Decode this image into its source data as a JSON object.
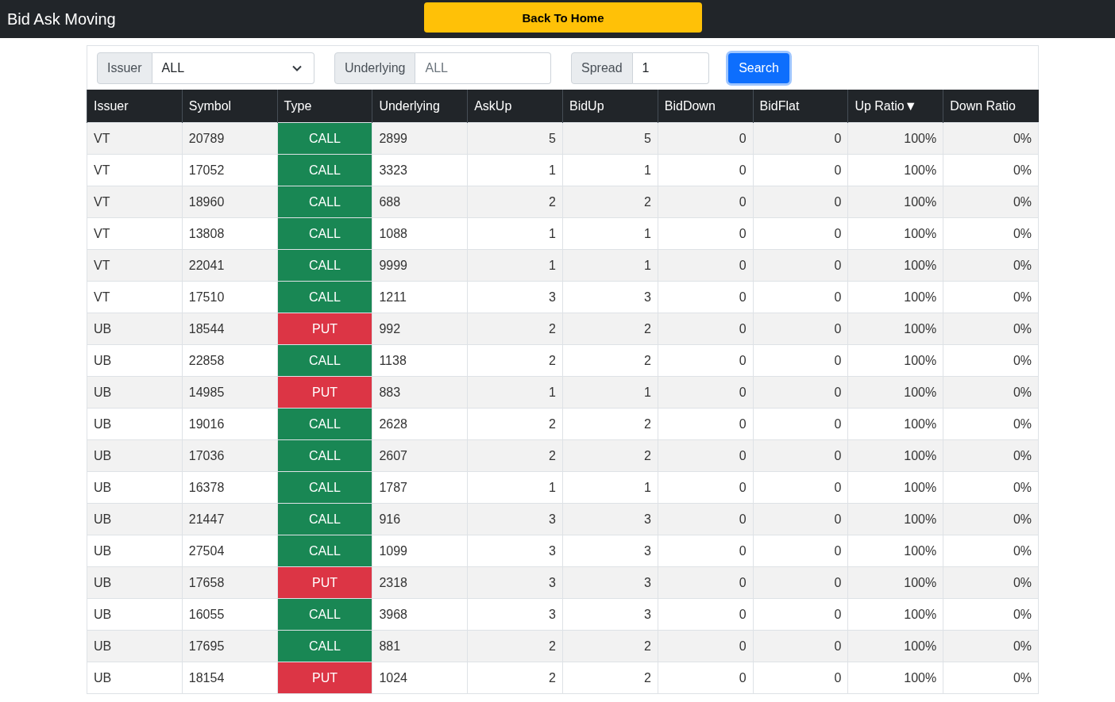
{
  "navbar": {
    "title": "Bid Ask Moving",
    "home_button": "Back To Home"
  },
  "filters": {
    "issuer": {
      "label": "Issuer",
      "value": "ALL"
    },
    "underlying": {
      "label": "Underlying",
      "placeholder": "ALL"
    },
    "spread": {
      "label": "Spread",
      "value": "1"
    },
    "search_button": "Search"
  },
  "table": {
    "columns": [
      "Issuer",
      "Symbol",
      "Type",
      "Underlying",
      "AskUp",
      "BidUp",
      "BidDown",
      "BidFlat",
      "Up Ratio▼",
      "Down Ratio"
    ],
    "rows": [
      {
        "issuer": "VT",
        "symbol": "20789",
        "type": "CALL",
        "color": "#198754",
        "underlying": "2899",
        "ask_up": "5",
        "bid_up": "5",
        "bid_down": "0",
        "bid_flat": "0",
        "up_ratio": "100%",
        "down_ratio": "0%"
      },
      {
        "issuer": "VT",
        "symbol": "17052",
        "type": "CALL",
        "color": "#198754",
        "underlying": "3323",
        "ask_up": "1",
        "bid_up": "1",
        "bid_down": "0",
        "bid_flat": "0",
        "up_ratio": "100%",
        "down_ratio": "0%"
      },
      {
        "issuer": "VT",
        "symbol": "18960",
        "type": "CALL",
        "color": "#198754",
        "underlying": "688",
        "ask_up": "2",
        "bid_up": "2",
        "bid_down": "0",
        "bid_flat": "0",
        "up_ratio": "100%",
        "down_ratio": "0%"
      },
      {
        "issuer": "VT",
        "symbol": "13808",
        "type": "CALL",
        "color": "#198754",
        "underlying": "1088",
        "ask_up": "1",
        "bid_up": "1",
        "bid_down": "0",
        "bid_flat": "0",
        "up_ratio": "100%",
        "down_ratio": "0%"
      },
      {
        "issuer": "VT",
        "symbol": "22041",
        "type": "CALL",
        "color": "#198754",
        "underlying": "9999",
        "ask_up": "1",
        "bid_up": "1",
        "bid_down": "0",
        "bid_flat": "0",
        "up_ratio": "100%",
        "down_ratio": "0%"
      },
      {
        "issuer": "VT",
        "symbol": "17510",
        "type": "CALL",
        "color": "#198754",
        "underlying": "1211",
        "ask_up": "3",
        "bid_up": "3",
        "bid_down": "0",
        "bid_flat": "0",
        "up_ratio": "100%",
        "down_ratio": "0%"
      },
      {
        "issuer": "UB",
        "symbol": "18544",
        "type": "PUT",
        "color": "#dc3545",
        "underlying": "992",
        "ask_up": "2",
        "bid_up": "2",
        "bid_down": "0",
        "bid_flat": "0",
        "up_ratio": "100%",
        "down_ratio": "0%"
      },
      {
        "issuer": "UB",
        "symbol": "22858",
        "type": "CALL",
        "color": "#198754",
        "underlying": "1138",
        "ask_up": "2",
        "bid_up": "2",
        "bid_down": "0",
        "bid_flat": "0",
        "up_ratio": "100%",
        "down_ratio": "0%"
      },
      {
        "issuer": "UB",
        "symbol": "14985",
        "type": "PUT",
        "color": "#dc3545",
        "underlying": "883",
        "ask_up": "1",
        "bid_up": "1",
        "bid_down": "0",
        "bid_flat": "0",
        "up_ratio": "100%",
        "down_ratio": "0%"
      },
      {
        "issuer": "UB",
        "symbol": "19016",
        "type": "CALL",
        "color": "#198754",
        "underlying": "2628",
        "ask_up": "2",
        "bid_up": "2",
        "bid_down": "0",
        "bid_flat": "0",
        "up_ratio": "100%",
        "down_ratio": "0%"
      },
      {
        "issuer": "UB",
        "symbol": "17036",
        "type": "CALL",
        "color": "#198754",
        "underlying": "2607",
        "ask_up": "2",
        "bid_up": "2",
        "bid_down": "0",
        "bid_flat": "0",
        "up_ratio": "100%",
        "down_ratio": "0%"
      },
      {
        "issuer": "UB",
        "symbol": "16378",
        "type": "CALL",
        "color": "#198754",
        "underlying": "1787",
        "ask_up": "1",
        "bid_up": "1",
        "bid_down": "0",
        "bid_flat": "0",
        "up_ratio": "100%",
        "down_ratio": "0%"
      },
      {
        "issuer": "UB",
        "symbol": "21447",
        "type": "CALL",
        "color": "#198754",
        "underlying": "916",
        "ask_up": "3",
        "bid_up": "3",
        "bid_down": "0",
        "bid_flat": "0",
        "up_ratio": "100%",
        "down_ratio": "0%"
      },
      {
        "issuer": "UB",
        "symbol": "27504",
        "type": "CALL",
        "color": "#198754",
        "underlying": "1099",
        "ask_up": "3",
        "bid_up": "3",
        "bid_down": "0",
        "bid_flat": "0",
        "up_ratio": "100%",
        "down_ratio": "0%"
      },
      {
        "issuer": "UB",
        "symbol": "17658",
        "type": "PUT",
        "color": "#dc3545",
        "underlying": "2318",
        "ask_up": "3",
        "bid_up": "3",
        "bid_down": "0",
        "bid_flat": "0",
        "up_ratio": "100%",
        "down_ratio": "0%"
      },
      {
        "issuer": "UB",
        "symbol": "16055",
        "type": "CALL",
        "color": "#198754",
        "underlying": "3968",
        "ask_up": "3",
        "bid_up": "3",
        "bid_down": "0",
        "bid_flat": "0",
        "up_ratio": "100%",
        "down_ratio": "0%"
      },
      {
        "issuer": "UB",
        "symbol": "17695",
        "type": "CALL",
        "color": "#198754",
        "underlying": "881",
        "ask_up": "2",
        "bid_up": "2",
        "bid_down": "0",
        "bid_flat": "0",
        "up_ratio": "100%",
        "down_ratio": "0%"
      },
      {
        "issuer": "UB",
        "symbol": "18154",
        "type": "PUT",
        "color": "#dc3545",
        "underlying": "1024",
        "ask_up": "2",
        "bid_up": "2",
        "bid_down": "0",
        "bid_flat": "0",
        "up_ratio": "100%",
        "down_ratio": "0%"
      }
    ]
  }
}
